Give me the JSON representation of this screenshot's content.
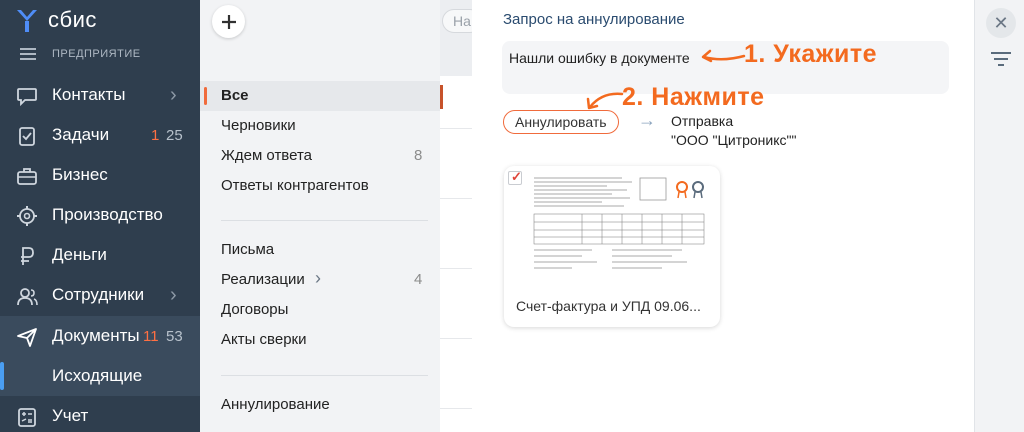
{
  "brand": {
    "name": "сбис"
  },
  "org": {
    "label": "ПРЕДПРИЯТИЕ"
  },
  "nav": {
    "items": [
      {
        "label": "Контакты",
        "icon": "chat-icon",
        "chevron": "›"
      },
      {
        "label": "Задачи",
        "icon": "task-icon",
        "count_new": "1",
        "count_total": "25"
      },
      {
        "label": "Бизнес",
        "icon": "briefcase-icon"
      },
      {
        "label": "Производство",
        "icon": "gear-icon"
      },
      {
        "label": "Деньги",
        "icon": "ruble-icon"
      },
      {
        "label": "Сотрудники",
        "icon": "people-icon",
        "chevron": "›"
      },
      {
        "label": "Документы",
        "icon": "send-icon",
        "count_new": "11",
        "count_total": "53"
      },
      {
        "label": "Учет",
        "icon": "calculator-icon"
      }
    ],
    "sub_item": "Исходящие"
  },
  "folders": {
    "group1": [
      {
        "label": "Все",
        "count": ""
      },
      {
        "label": "Черновики",
        "count": ""
      },
      {
        "label": "Ждем ответа",
        "count": "8"
      },
      {
        "label": "Ответы контрагентов",
        "count": ""
      }
    ],
    "group2": [
      {
        "label": "Письма",
        "count": ""
      },
      {
        "label": "Реализации",
        "count": "4",
        "chevron": "›"
      },
      {
        "label": "Договоры",
        "count": ""
      },
      {
        "label": "Акты сверки",
        "count": ""
      }
    ],
    "group3": [
      {
        "label": "Аннулирование",
        "count": ""
      }
    ]
  },
  "list": {
    "search_placeholder": "На"
  },
  "panel": {
    "title": "Запрос на аннулирование",
    "comment": "Нашли ошибку в документе",
    "hint1": "1. Укажите",
    "hint2": "2. Нажмите",
    "annul_button": "Аннулировать",
    "arrow": "→",
    "send_text": "Отправка\n\"ООО \"Цитроникс\"\"",
    "document": {
      "name": "Счет-фактура и УПД 09.06...",
      "checked": true
    }
  },
  "rail": {
    "close": "✕"
  },
  "colors": {
    "nav_bg": "#2f3e4e",
    "accent": "#f06b3c",
    "hint": "#f36a1f",
    "active_bar": "#4a9ef2",
    "title": "#2a4b6f"
  }
}
